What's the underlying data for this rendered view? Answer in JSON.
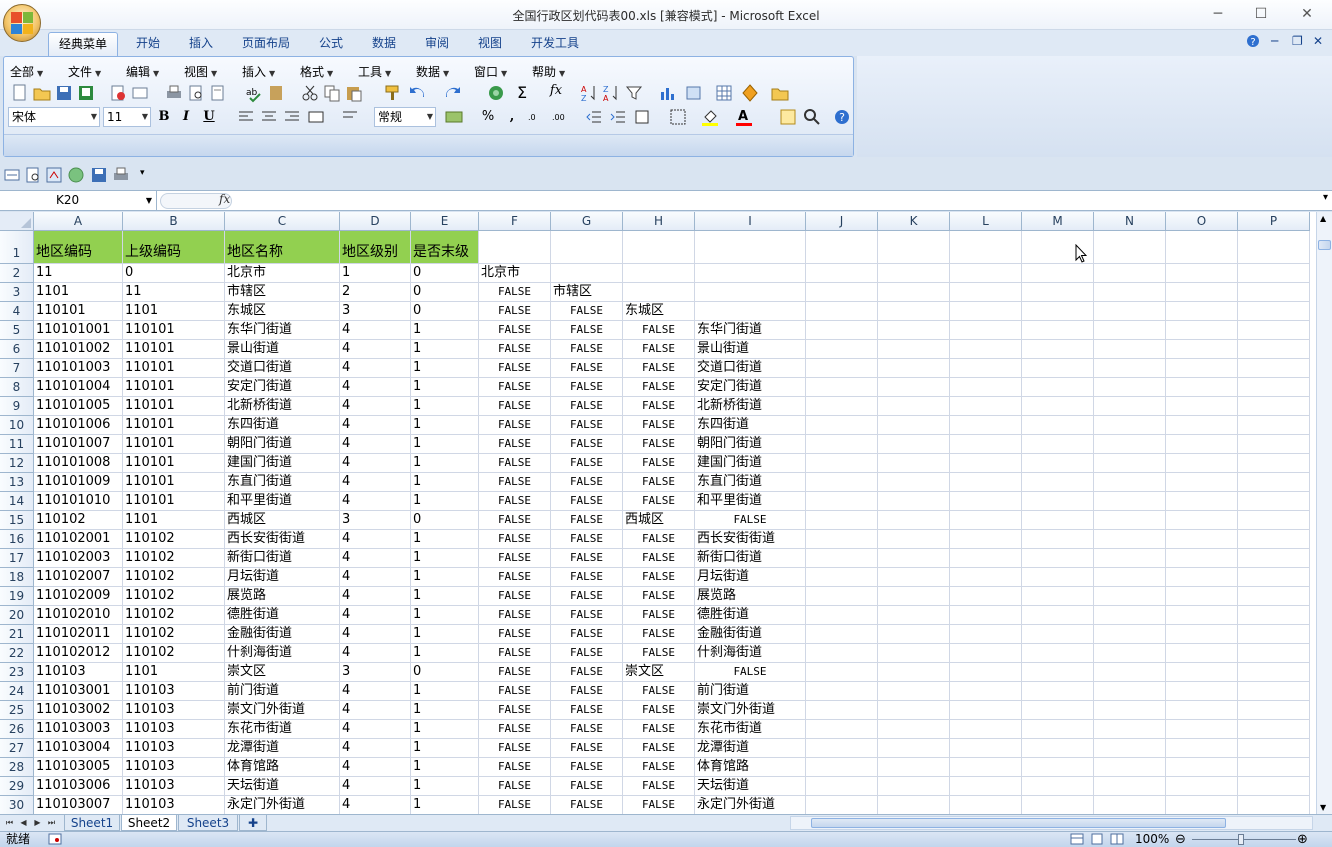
{
  "window": {
    "title": "全国行政区划代码表00.xls  [兼容模式] - Microsoft Excel",
    "controls": [
      "─",
      "☐",
      "✕"
    ]
  },
  "ribbon_tabs": [
    "经典菜单",
    "开始",
    "插入",
    "页面布局",
    "公式",
    "数据",
    "审阅",
    "视图",
    "开发工具"
  ],
  "classic_menu": [
    "全部",
    "文件",
    "编辑",
    "视图",
    "插入",
    "格式",
    "工具",
    "数据",
    "窗口",
    "帮助"
  ],
  "format_bar": {
    "font_name": "宋体",
    "font_size": "11",
    "bold": "B",
    "italic": "I",
    "underline": "U",
    "number_format": "常规",
    "percent": "%",
    "comma": ","
  },
  "formula_bar": {
    "name_box": "K20",
    "fx": "fx",
    "formula": ""
  },
  "columns": [
    "A",
    "B",
    "C",
    "D",
    "E",
    "F",
    "G",
    "H",
    "I",
    "J",
    "K",
    "L",
    "M",
    "N",
    "O",
    "P"
  ],
  "header_row": [
    "地区编码",
    "上级编码",
    "地区名称",
    "地区级别",
    "是否末级"
  ],
  "rows": [
    {
      "n": "2",
      "a": "11",
      "b": "0",
      "c": "北京市",
      "d": "1",
      "e": "0",
      "f": "北京市",
      "g": "",
      "h": "",
      "i": ""
    },
    {
      "n": "3",
      "a": "1101",
      "b": "11",
      "c": "市辖区",
      "d": "2",
      "e": "0",
      "f": "FALSE",
      "g": "市辖区",
      "h": "",
      "i": ""
    },
    {
      "n": "4",
      "a": "110101",
      "b": "1101",
      "c": "东城区",
      "d": "3",
      "e": "0",
      "f": "FALSE",
      "g": "FALSE",
      "h": "东城区",
      "i": ""
    },
    {
      "n": "5",
      "a": "110101001",
      "b": "110101",
      "c": "东华门街道",
      "d": "4",
      "e": "1",
      "f": "FALSE",
      "g": "FALSE",
      "h": "FALSE",
      "i": "东华门街道"
    },
    {
      "n": "6",
      "a": "110101002",
      "b": "110101",
      "c": "景山街道",
      "d": "4",
      "e": "1",
      "f": "FALSE",
      "g": "FALSE",
      "h": "FALSE",
      "i": "景山街道"
    },
    {
      "n": "7",
      "a": "110101003",
      "b": "110101",
      "c": "交道口街道",
      "d": "4",
      "e": "1",
      "f": "FALSE",
      "g": "FALSE",
      "h": "FALSE",
      "i": "交道口街道"
    },
    {
      "n": "8",
      "a": "110101004",
      "b": "110101",
      "c": "安定门街道",
      "d": "4",
      "e": "1",
      "f": "FALSE",
      "g": "FALSE",
      "h": "FALSE",
      "i": "安定门街道"
    },
    {
      "n": "9",
      "a": "110101005",
      "b": "110101",
      "c": "北新桥街道",
      "d": "4",
      "e": "1",
      "f": "FALSE",
      "g": "FALSE",
      "h": "FALSE",
      "i": "北新桥街道"
    },
    {
      "n": "10",
      "a": "110101006",
      "b": "110101",
      "c": "东四街道",
      "d": "4",
      "e": "1",
      "f": "FALSE",
      "g": "FALSE",
      "h": "FALSE",
      "i": "东四街道"
    },
    {
      "n": "11",
      "a": "110101007",
      "b": "110101",
      "c": "朝阳门街道",
      "d": "4",
      "e": "1",
      "f": "FALSE",
      "g": "FALSE",
      "h": "FALSE",
      "i": "朝阳门街道"
    },
    {
      "n": "12",
      "a": "110101008",
      "b": "110101",
      "c": "建国门街道",
      "d": "4",
      "e": "1",
      "f": "FALSE",
      "g": "FALSE",
      "h": "FALSE",
      "i": "建国门街道"
    },
    {
      "n": "13",
      "a": "110101009",
      "b": "110101",
      "c": "东直门街道",
      "d": "4",
      "e": "1",
      "f": "FALSE",
      "g": "FALSE",
      "h": "FALSE",
      "i": "东直门街道"
    },
    {
      "n": "14",
      "a": "110101010",
      "b": "110101",
      "c": "和平里街道",
      "d": "4",
      "e": "1",
      "f": "FALSE",
      "g": "FALSE",
      "h": "FALSE",
      "i": "和平里街道"
    },
    {
      "n": "15",
      "a": "110102",
      "b": "1101",
      "c": "西城区",
      "d": "3",
      "e": "0",
      "f": "FALSE",
      "g": "FALSE",
      "h": "西城区",
      "i": "FALSE"
    },
    {
      "n": "16",
      "a": "110102001",
      "b": "110102",
      "c": "西长安街街道",
      "d": "4",
      "e": "1",
      "f": "FALSE",
      "g": "FALSE",
      "h": "FALSE",
      "i": "西长安街街道"
    },
    {
      "n": "17",
      "a": "110102003",
      "b": "110102",
      "c": "新街口街道",
      "d": "4",
      "e": "1",
      "f": "FALSE",
      "g": "FALSE",
      "h": "FALSE",
      "i": "新街口街道"
    },
    {
      "n": "18",
      "a": "110102007",
      "b": "110102",
      "c": "月坛街道",
      "d": "4",
      "e": "1",
      "f": "FALSE",
      "g": "FALSE",
      "h": "FALSE",
      "i": "月坛街道"
    },
    {
      "n": "19",
      "a": "110102009",
      "b": "110102",
      "c": "展览路",
      "d": "4",
      "e": "1",
      "f": "FALSE",
      "g": "FALSE",
      "h": "FALSE",
      "i": "展览路"
    },
    {
      "n": "20",
      "a": "110102010",
      "b": "110102",
      "c": "德胜街道",
      "d": "4",
      "e": "1",
      "f": "FALSE",
      "g": "FALSE",
      "h": "FALSE",
      "i": "德胜街道"
    },
    {
      "n": "21",
      "a": "110102011",
      "b": "110102",
      "c": "金融街街道",
      "d": "4",
      "e": "1",
      "f": "FALSE",
      "g": "FALSE",
      "h": "FALSE",
      "i": "金融街街道"
    },
    {
      "n": "22",
      "a": "110102012",
      "b": "110102",
      "c": "什刹海街道",
      "d": "4",
      "e": "1",
      "f": "FALSE",
      "g": "FALSE",
      "h": "FALSE",
      "i": "什刹海街道"
    },
    {
      "n": "23",
      "a": "110103",
      "b": "1101",
      "c": "崇文区",
      "d": "3",
      "e": "0",
      "f": "FALSE",
      "g": "FALSE",
      "h": "崇文区",
      "i": "FALSE"
    },
    {
      "n": "24",
      "a": "110103001",
      "b": "110103",
      "c": "前门街道",
      "d": "4",
      "e": "1",
      "f": "FALSE",
      "g": "FALSE",
      "h": "FALSE",
      "i": "前门街道"
    },
    {
      "n": "25",
      "a": "110103002",
      "b": "110103",
      "c": "崇文门外街道",
      "d": "4",
      "e": "1",
      "f": "FALSE",
      "g": "FALSE",
      "h": "FALSE",
      "i": "崇文门外街道"
    },
    {
      "n": "26",
      "a": "110103003",
      "b": "110103",
      "c": "东花市街道",
      "d": "4",
      "e": "1",
      "f": "FALSE",
      "g": "FALSE",
      "h": "FALSE",
      "i": "东花市街道"
    },
    {
      "n": "27",
      "a": "110103004",
      "b": "110103",
      "c": "龙潭街道",
      "d": "4",
      "e": "1",
      "f": "FALSE",
      "g": "FALSE",
      "h": "FALSE",
      "i": "龙潭街道"
    },
    {
      "n": "28",
      "a": "110103005",
      "b": "110103",
      "c": "体育馆路",
      "d": "4",
      "e": "1",
      "f": "FALSE",
      "g": "FALSE",
      "h": "FALSE",
      "i": "体育馆路"
    },
    {
      "n": "29",
      "a": "110103006",
      "b": "110103",
      "c": "天坛街道",
      "d": "4",
      "e": "1",
      "f": "FALSE",
      "g": "FALSE",
      "h": "FALSE",
      "i": "天坛街道"
    },
    {
      "n": "30",
      "a": "110103007",
      "b": "110103",
      "c": "永定门外街道",
      "d": "4",
      "e": "1",
      "f": "FALSE",
      "g": "FALSE",
      "h": "FALSE",
      "i": "永定门外街道"
    }
  ],
  "sheets": [
    "Sheet1",
    "Sheet2",
    "Sheet3"
  ],
  "active_sheet": "Sheet2",
  "status": {
    "ready": "就绪",
    "zoom": "100%"
  },
  "colors": {
    "header_fill": "#92d050",
    "grid_line": "#d0d7e5",
    "header_border": "#9eb6ce",
    "ribbon_text": "#15428b"
  }
}
